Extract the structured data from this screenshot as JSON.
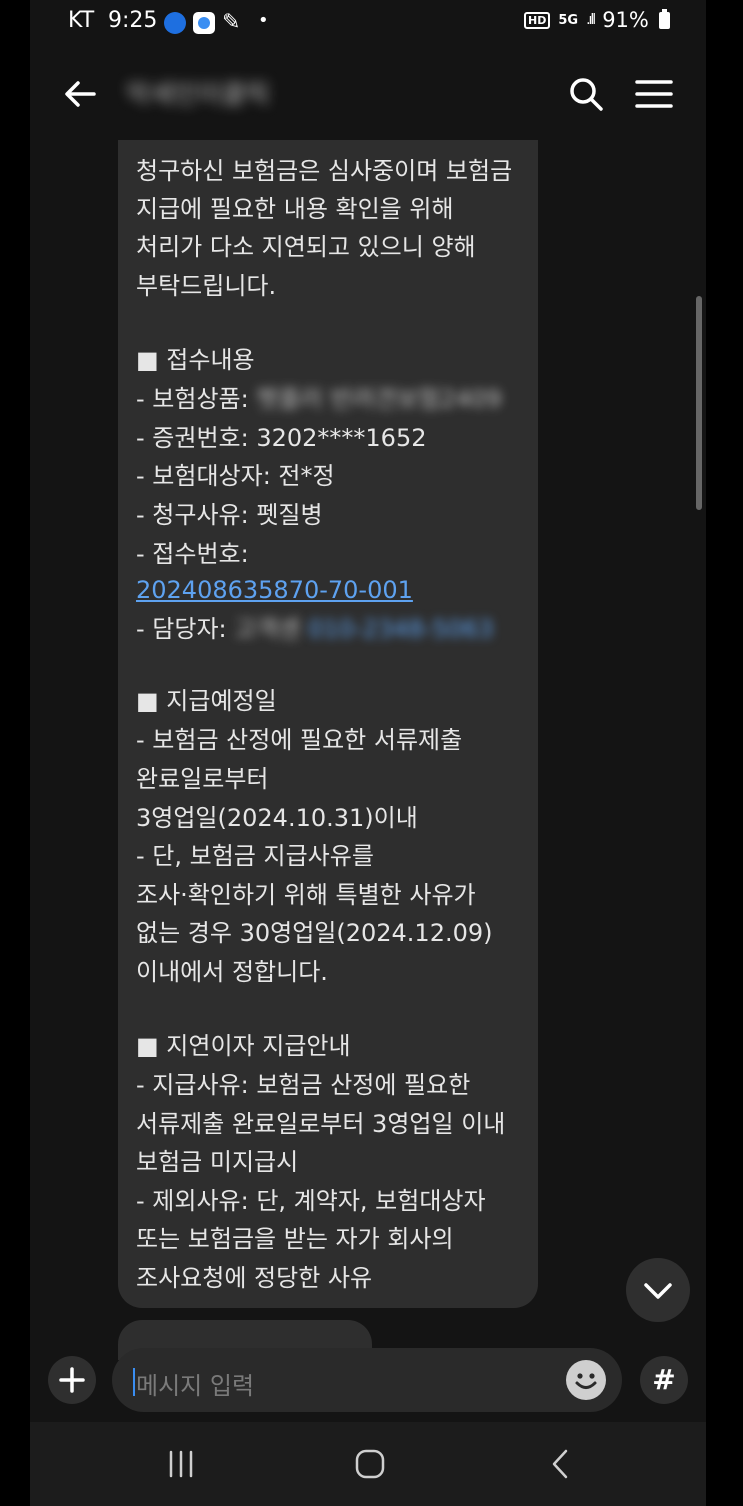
{
  "status_bar": {
    "carrier": "KT",
    "time": "9:25",
    "network": "5G",
    "hd": "HD",
    "battery": "91%"
  },
  "header": {
    "sender_name": "악세인이클릭"
  },
  "message": {
    "lines": [
      "청구하신 보험금은 심사중이며 보험금",
      "지급에 필요한 내용 확인을 위해",
      "처리가 다소 지연되고 있으니 양해",
      "부탁드립니다.",
      "■ 접수내용",
      " - 보험상품:",
      " - 증권번호: 3202****1652",
      " - 보험대상자: 전*정",
      " - 청구사유: 펫질병",
      " - 접수번호:",
      " - 담당자:",
      "■ 지급예정일",
      " - 보험금 산정에 필요한 서류제출",
      "완료일로부터",
      "3영업일(2024.10.31)이내",
      " - 단, 보험금 지급사유를",
      "조사·확인하기 위해 특별한 사유가",
      "없는 경우 30영업일(2024.12.09)",
      "이내에서 정합니다.",
      "■ 지연이자 지급안내",
      " - 지급사유: 보험금 산정에 필요한",
      "서류제출 완료일로부터 3영업일 이내",
      "보험금 미지급시",
      " - 제외사유: 단, 계약자, 보험대상자",
      "또는 보험금을 받는 자가 회사의",
      "조사요청에 정당한 사유"
    ],
    "blurred_product": "펫플러 반려견보험2409",
    "receipt_number": "202408635870-70-001",
    "blurred_manager": "고객센",
    "blurred_phone": "010-2348-5063"
  },
  "input": {
    "placeholder": "메시지 입력",
    "hash_label": "#"
  },
  "colors": {
    "background": "#141414",
    "bubble": "#2e2e2e",
    "link": "#5ea2f0",
    "caret": "#3a8ef2"
  },
  "icons": [
    "back-arrow-icon",
    "search-icon",
    "menu-icon",
    "chevron-down-icon",
    "plus-icon",
    "emoji-icon",
    "hash-icon",
    "recent-apps-icon",
    "home-icon",
    "nav-back-icon"
  ]
}
